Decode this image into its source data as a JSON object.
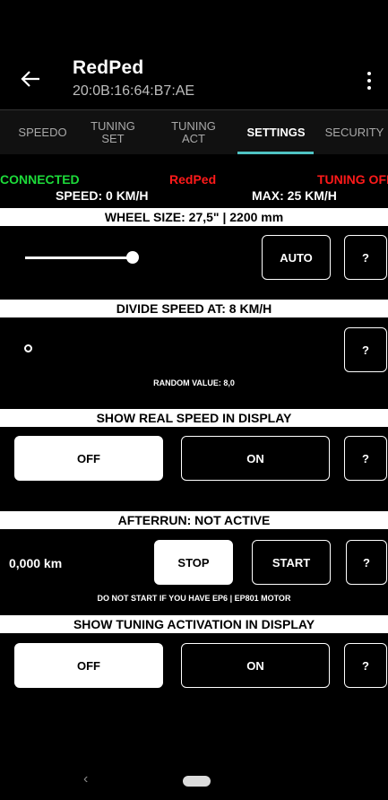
{
  "app_bar": {
    "title": "RedPed",
    "subtitle": "20:0B:16:64:B7:AE",
    "back_icon": "arrow-left-icon",
    "menu_icon": "more-vertical-icon"
  },
  "tabs": [
    {
      "label": "SPEEDO",
      "active": false
    },
    {
      "label": "TUNING SET",
      "active": false
    },
    {
      "label": "TUNING ACT",
      "active": false
    },
    {
      "label": "SETTINGS",
      "active": true
    },
    {
      "label": "SECURITY",
      "active": false
    }
  ],
  "status": {
    "connection": "CONNECTED",
    "device": "RedPed",
    "tuning": "TUNING OFF",
    "speed": "SPEED: 0 KM/H",
    "max": "MAX: 25 KM/H"
  },
  "wheel_size": {
    "header": "WHEEL SIZE: 27,5\" | 2200 mm",
    "auto_label": "AUTO",
    "help_label": "?"
  },
  "divide_speed": {
    "header": "DIVIDE SPEED AT: 8 KM/H",
    "random_value": "RANDOM VALUE: 8,0",
    "help_label": "?"
  },
  "real_speed": {
    "header": "SHOW REAL SPEED IN DISPLAY",
    "off_label": "OFF",
    "on_label": "ON",
    "help_label": "?",
    "selected": "OFF"
  },
  "afterrun": {
    "header": "AFTERRUN: NOT ACTIVE",
    "distance": "0,000 km",
    "stop_label": "STOP",
    "start_label": "START",
    "help_label": "?",
    "warning": "DO NOT START IF YOU HAVE EP6 | EP801 MOTOR"
  },
  "tuning_activation": {
    "header": "SHOW TUNING ACTIVATION IN DISPLAY",
    "off_label": "OFF",
    "on_label": "ON",
    "help_label": "?",
    "selected": "OFF"
  },
  "colors": {
    "connected": "#1ddb3a",
    "alert": "#ff1a1a",
    "tab_indicator": "#4fc3c3"
  },
  "nav_bar": {
    "back_icon": "chevron-left-icon",
    "home_icon": "home-pill-icon"
  }
}
